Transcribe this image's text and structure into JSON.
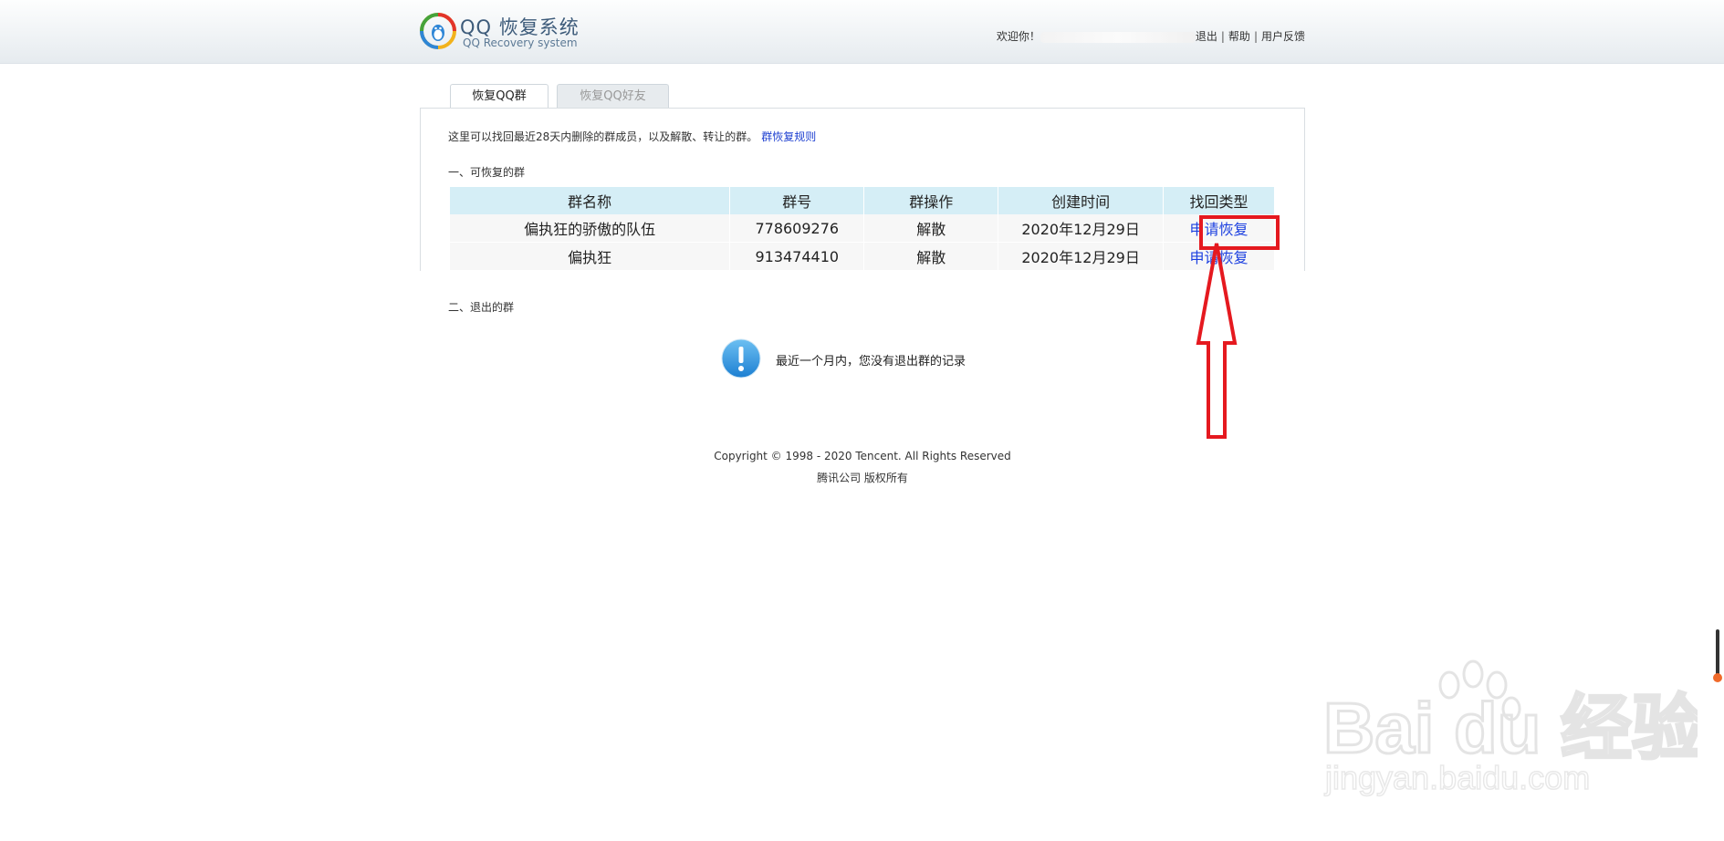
{
  "header": {
    "brand_title": "QQ 恢复系统",
    "brand_subtitle": "QQ Recovery system",
    "welcome": "欢迎你！",
    "logout_tail": "退出",
    "help": "帮助",
    "feedback": "用户反馈",
    "separator": "|"
  },
  "tabs": [
    {
      "label": "恢复QQ群",
      "active": true
    },
    {
      "label": "恢复QQ好友",
      "active": false
    }
  ],
  "intro": {
    "text": "这里可以找回最近28天内删除的群成员，以及解散、转让的群。",
    "link": "群恢复规则"
  },
  "sections": {
    "recoverable_title": "一、可恢复的群",
    "exited_title": "二、退出的群"
  },
  "table": {
    "headers": [
      "群名称",
      "群号",
      "群操作",
      "创建时间",
      "找回类型"
    ],
    "rows": [
      {
        "name": "偏执狂的骄傲的队伍",
        "number": "778609276",
        "action": "解散",
        "created": "2020年12月29日",
        "recover": "申请恢复"
      },
      {
        "name": "偏执狂",
        "number": "913474410",
        "action": "解散",
        "created": "2020年12月29日",
        "recover": "申请恢复"
      }
    ]
  },
  "notice": {
    "text": "最近一个月内，您没有退出群的记录"
  },
  "footer": {
    "copyright": "Copyright © 1998 - 2020 Tencent. All Rights Reserved",
    "rights": "腾讯公司 版权所有"
  },
  "watermark": {
    "brand": "Bai du 经验",
    "url": "jingyan.baidu.com"
  },
  "colors": {
    "link": "#1b3fe0",
    "header_cell": "#d5eef6",
    "highlight": "#e5191f",
    "notice_icon": "#2d8fd9"
  }
}
